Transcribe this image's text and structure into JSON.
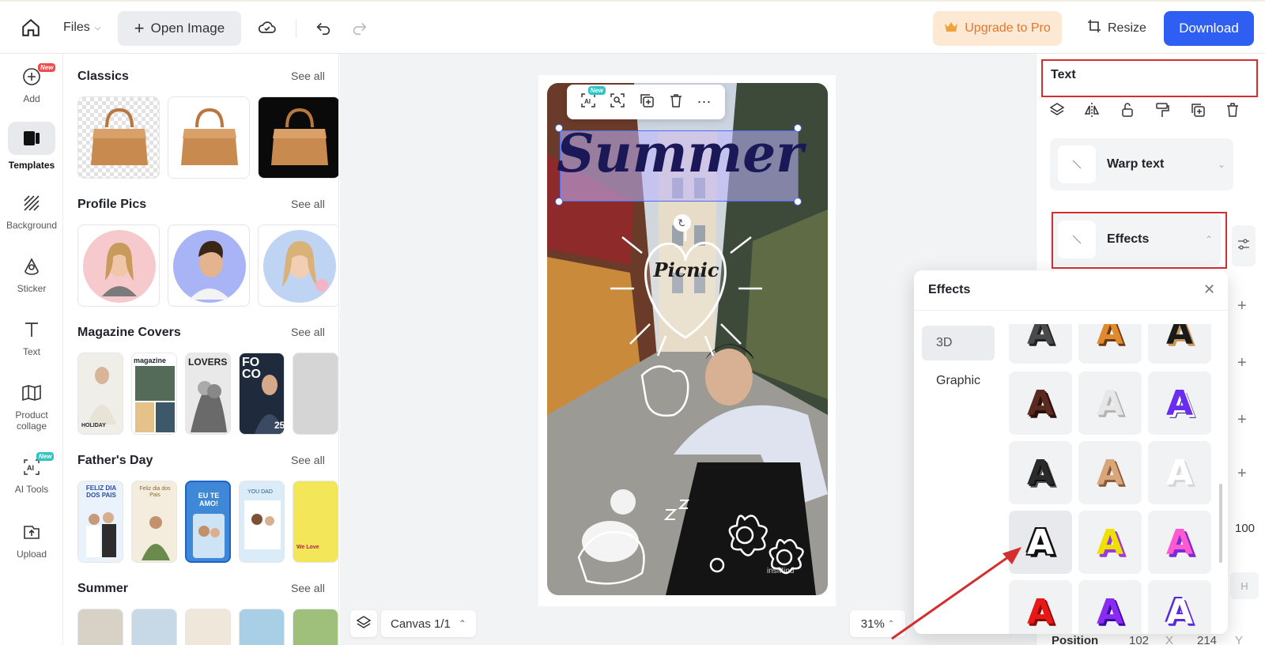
{
  "topbar": {
    "files_label": "Files",
    "open_image_label": "Open Image",
    "upgrade_label": "Upgrade to Pro",
    "resize_label": "Resize",
    "download_label": "Download"
  },
  "rail": {
    "items": [
      {
        "label": "Add",
        "icon": "plus-circle-icon",
        "badge": "New"
      },
      {
        "label": "Templates",
        "icon": "templates-icon"
      },
      {
        "label": "Background",
        "icon": "background-icon"
      },
      {
        "label": "Sticker",
        "icon": "sticker-icon"
      },
      {
        "label": "Text",
        "icon": "text-icon"
      },
      {
        "label": "Product collage",
        "icon": "collage-icon"
      },
      {
        "label": "AI Tools",
        "icon": "ai-tools-icon",
        "badge": "New"
      },
      {
        "label": "Upload",
        "icon": "upload-icon"
      }
    ]
  },
  "templates": {
    "see_all": "See all",
    "sections": [
      {
        "title": "Classics"
      },
      {
        "title": "Profile Pics"
      },
      {
        "title": "Magazine Covers"
      },
      {
        "title": "Father's Day"
      },
      {
        "title": "Summer"
      }
    ],
    "magazine_texts": [
      "magazine",
      "LOVERS",
      "FO CO",
      "HOLIDAY",
      "25"
    ],
    "fathers_texts": [
      "FELIZ DIA DOS PAIS",
      "Feliz dia dos Pais",
      "EU TE AMO!",
      "YOU DAD",
      "We Love"
    ]
  },
  "canvas": {
    "headline": "Summer",
    "subtext": "Picnic",
    "ai_badge": "New",
    "watermark": "insMind",
    "canvas_label": "Canvas 1/1",
    "zoom": "31%"
  },
  "right_panel": {
    "title": "Text",
    "warp_label": "Warp text",
    "effects_label": "Effects",
    "opacity_value": "100",
    "h_label": "H",
    "position_label": "Position",
    "pos_x": "102",
    "x_label": "X",
    "pos_y": "214",
    "y_label": "Y"
  },
  "effects_popup": {
    "title": "Effects",
    "categories": [
      "3D",
      "Graphic"
    ],
    "preview_letter": "A"
  },
  "colors": {
    "accent": "#2f5ef3",
    "upgrade_bg": "#fde9d3",
    "upgrade_text": "#e0772e",
    "highlight": "#d32f2f",
    "new_badge_red": "#f5484a",
    "new_badge_teal": "#2ec4c4"
  }
}
